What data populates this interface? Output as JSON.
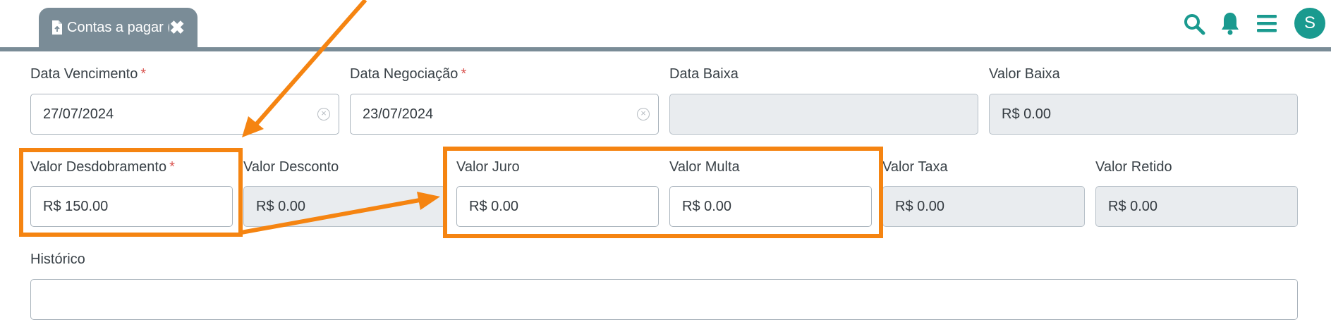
{
  "tab": {
    "label": "Contas a pagar (",
    "close_glyph": "✖"
  },
  "topbar": {
    "avatar_letter": "S",
    "accent_color": "#1a9a8f"
  },
  "form": {
    "data_vencimento": {
      "label": "Data Vencimento",
      "required": "*",
      "value": "27/07/2024"
    },
    "data_negociacao": {
      "label": "Data Negociação",
      "required": "*",
      "value": "23/07/2024"
    },
    "data_baixa": {
      "label": "Data Baixa",
      "value": ""
    },
    "valor_baixa": {
      "label": "Valor Baixa",
      "value": "R$ 0.00"
    },
    "valor_desdobramento": {
      "label": "Valor Desdobramento",
      "required": "*",
      "value": "R$ 150.00"
    },
    "valor_desconto": {
      "label": "Valor Desconto",
      "value": "R$ 0.00"
    },
    "valor_juro": {
      "label": "Valor Juro",
      "value": "R$ 0.00"
    },
    "valor_multa": {
      "label": "Valor Multa",
      "value": "R$ 0.00"
    },
    "valor_taxa": {
      "label": "Valor Taxa",
      "value": "R$ 0.00"
    },
    "valor_retido": {
      "label": "Valor Retido",
      "value": "R$ 0.00"
    },
    "historico": {
      "label": "Histórico",
      "value": ""
    }
  },
  "annotation_color": "#f58411"
}
